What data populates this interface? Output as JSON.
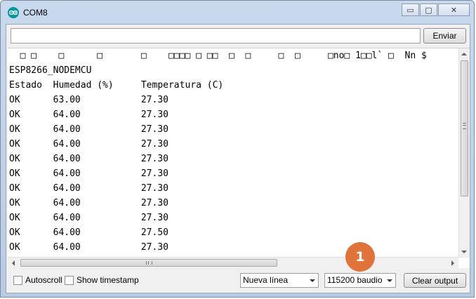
{
  "window": {
    "title": "COM8",
    "controls": {
      "minimize": "▭",
      "maximize": "▢",
      "close": "✕"
    }
  },
  "send": {
    "input_value": "",
    "button_label": "Enviar"
  },
  "output": {
    "lines": [
      "  □ □    □      □       □    □□□□ □ □□  □  □     □  □     □no□ 1□□l` □  Nn $",
      "ESP8266_NODEMCU",
      "Estado  Humedad (%)     Temperatura (C)",
      "OK      63.00           27.30",
      "OK      64.00           27.30",
      "OK      64.00           27.30",
      "OK      64.00           27.30",
      "OK      64.00           27.30",
      "OK      64.00           27.30",
      "OK      64.00           27.30",
      "OK      64.00           27.30",
      "OK      64.00           27.30",
      "OK      64.00           27.50",
      "OK      64.00           27.30"
    ]
  },
  "footer": {
    "autoscroll_label": "Autoscroll",
    "autoscroll_checked": false,
    "timestamp_label": "Show timestamp",
    "timestamp_checked": false,
    "line_ending_selected": "Nueva línea",
    "baud_selected": "115200 baudio",
    "clear_label": "Clear output"
  },
  "annotation": {
    "badge_number": "1",
    "badge_color": "#e0733a"
  },
  "colors": {
    "arduino_teal": "#00979c"
  }
}
